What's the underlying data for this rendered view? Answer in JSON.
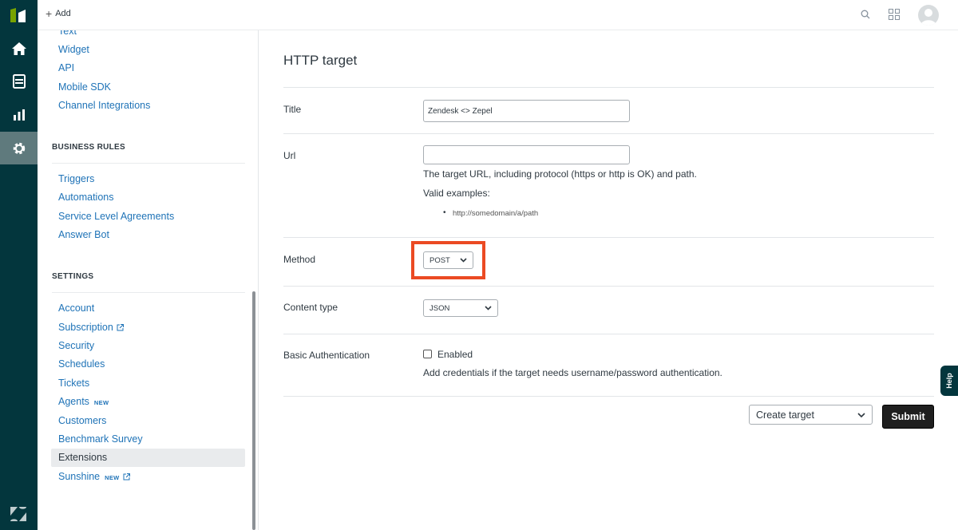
{
  "topbar": {
    "add_label": "Add"
  },
  "sidebar": {
    "top_links": [
      "Text",
      "Widget",
      "API",
      "Mobile SDK",
      "Channel Integrations"
    ],
    "business_rules": {
      "heading": "BUSINESS RULES",
      "items": [
        "Triggers",
        "Automations",
        "Service Level Agreements",
        "Answer Bot"
      ]
    },
    "settings": {
      "heading": "SETTINGS",
      "items": [
        "Account",
        "Subscription",
        "Security",
        "Schedules",
        "Tickets",
        "Agents",
        "Customers",
        "Benchmark Survey",
        "Extensions",
        "Sunshine"
      ],
      "new_tag": "NEW",
      "active": "Extensions"
    }
  },
  "main": {
    "page_title": "HTTP target",
    "fields": {
      "title_label": "Title",
      "title_value": "Zendesk <> Zepel",
      "url_label": "Url",
      "url_value": "",
      "url_hint": "The target URL, including protocol (https or http is OK) and path.",
      "url_examples_label": "Valid examples:",
      "url_example": "http://somedomain/a/path",
      "method_label": "Method",
      "method_value": "POST",
      "content_type_label": "Content type",
      "content_type_value": "JSON",
      "basic_auth_label": "Basic Authentication",
      "basic_auth_checkbox": "Enabled",
      "basic_auth_hint": "Add credentials if the target needs username/password authentication."
    },
    "action_select": "Create target",
    "submit_label": "Submit"
  },
  "help_tab": "Help",
  "colors": {
    "rail": "#03363d",
    "link": "#1f73b7",
    "highlight": "#eb4a23"
  }
}
